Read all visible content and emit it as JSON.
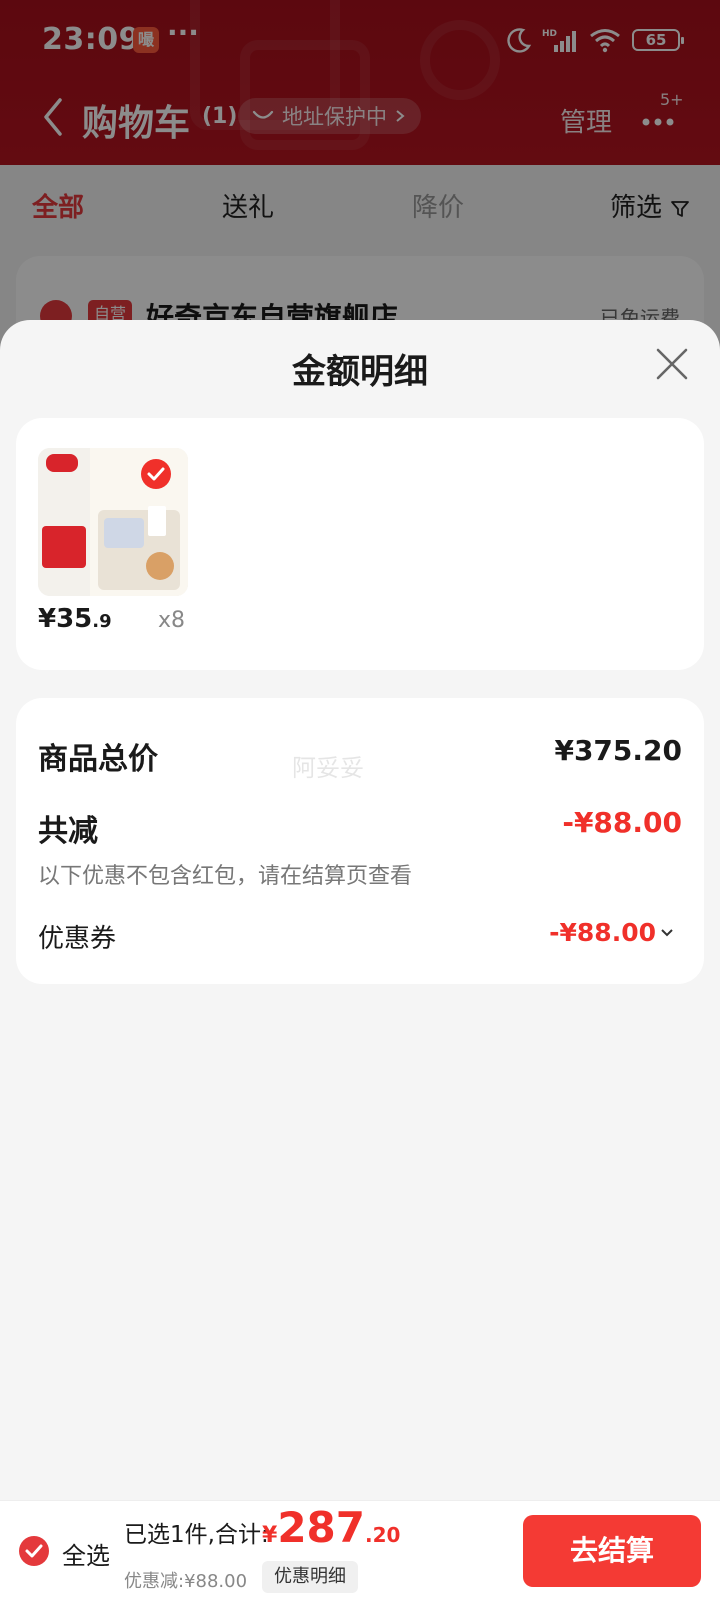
{
  "status_bar": {
    "time": "23:09",
    "app_badge": "嘬",
    "battery": "65"
  },
  "nav": {
    "title": "购物车",
    "count": "(1)",
    "address_pill": "地址保护中",
    "manage": "管理",
    "badge": "5+"
  },
  "tabs": [
    "全部",
    "送礼",
    "降价",
    "筛选"
  ],
  "shop": {
    "tag": "自营",
    "name": "好奇京东自营旗舰店",
    "freight": "已免运费"
  },
  "sheet": {
    "title": "金额明细",
    "item": {
      "price_int": "¥35",
      "price_dec": ".9",
      "qty": "x8"
    },
    "summary": {
      "total_label": "商品总价",
      "total_value": "¥375.20",
      "reduce_label": "共减",
      "reduce_value": "-¥88.00",
      "note": "以下优惠不包含红包，请在结算页查看",
      "coupon_label": "优惠券",
      "coupon_value": "-¥88.00",
      "watermark": "阿妥妥"
    }
  },
  "bottom": {
    "select_all": "全选",
    "selected_text": "已选1件,合计:",
    "total_yen": "¥",
    "total_int": "287",
    "total_dec": ".20",
    "discount_text": "优惠减:¥88.00",
    "detail_chip": "优惠明细",
    "checkout": "去结算"
  },
  "colors": {
    "brand_red": "#e4393c",
    "price_red": "#f0302a",
    "header_red": "#b51420"
  }
}
